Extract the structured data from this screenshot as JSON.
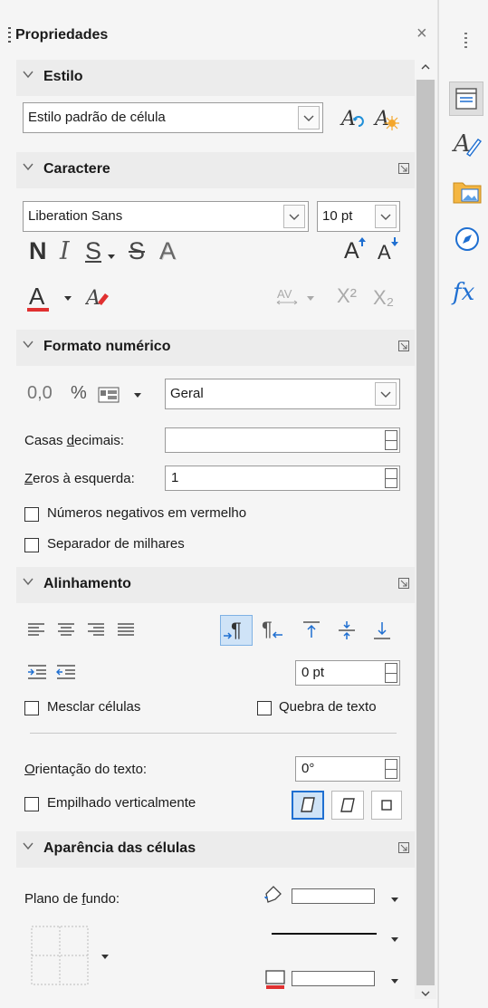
{
  "panel": {
    "title": "Propriedades"
  },
  "style_section": {
    "header": "Estilo",
    "cell_style": "Estilo padrão de célula"
  },
  "character_section": {
    "header": "Caractere",
    "font_name": "Liberation Sans",
    "font_size": "10 pt",
    "bold_glyph": "N",
    "italic_glyph": "I",
    "underline_glyph": "S",
    "strike_glyph": "S",
    "shadow_glyph": "A",
    "grow_glyph": "A",
    "shrink_glyph": "A",
    "font_color_glyph": "A",
    "superscript": "X²",
    "subscript": "X₂"
  },
  "number_section": {
    "header": "Formato numérico",
    "decimal_glyph": "0,0",
    "percent_glyph": "%",
    "format_value": "Geral",
    "decimals_label": "Casas decimais:",
    "decimals_value": "",
    "leading_zeros_label": "Zeros à esquerda:",
    "leading_zeros_value": "1",
    "negative_red_label": "Números negativos em vermelho",
    "thousands_label": "Separador de milhares"
  },
  "alignment_section": {
    "header": "Alinhamento",
    "indent_value": "0 pt",
    "merge_label": "Mesclar células",
    "wrap_label": "Quebra de texto",
    "orientation_label": "Orientação do texto:",
    "orientation_value": "0°",
    "stacked_label": "Empilhado verticalmente"
  },
  "appearance_section": {
    "header": "Aparência das células",
    "background_label": "Plano de fundo:"
  },
  "deck": {
    "function_glyph": "fx"
  },
  "colors": {
    "accent": "#1f6fd1",
    "font_red": "#e03030"
  }
}
